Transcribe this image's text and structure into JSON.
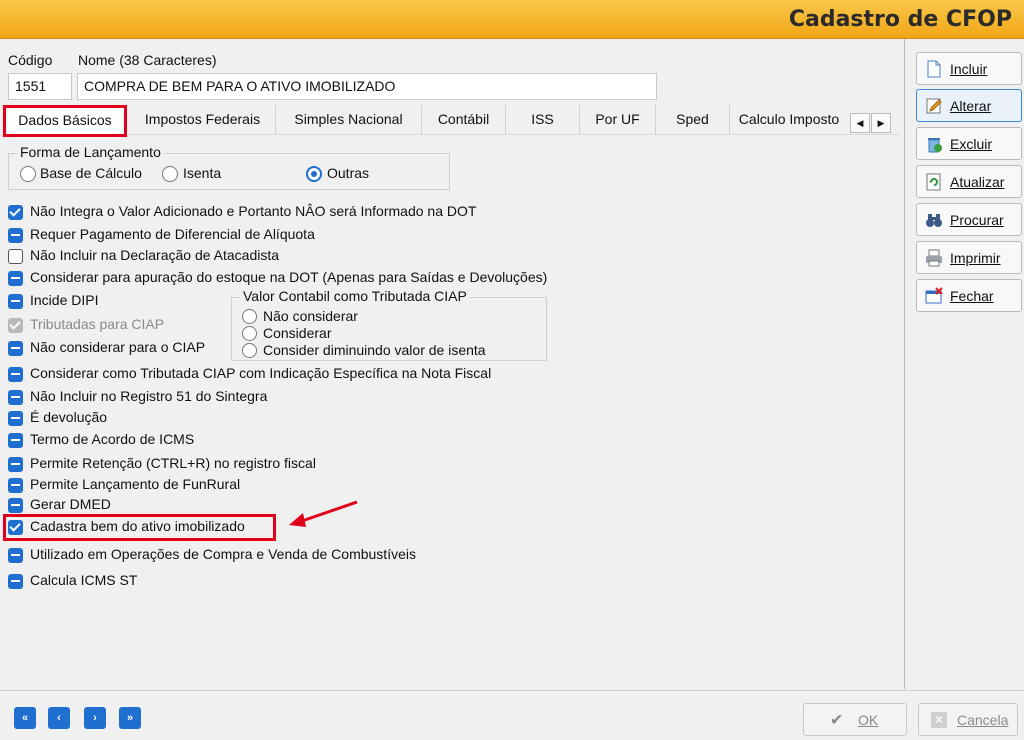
{
  "window": {
    "title": "Cadastro de CFOP"
  },
  "form": {
    "codigo_label": "Código",
    "nome_label": "Nome (38 Caracteres)",
    "codigo_value": "1551",
    "nome_value": "COMPRA DE BEM PARA O ATIVO IMOBILIZADO"
  },
  "tabs": [
    {
      "label": "Dados Básicos"
    },
    {
      "label": "Impostos Federais"
    },
    {
      "label": "Simples Nacional"
    },
    {
      "label": "Contábil"
    },
    {
      "label": "ISS"
    },
    {
      "label": "Por UF"
    },
    {
      "label": "Sped"
    },
    {
      "label": "Calculo Imposto"
    }
  ],
  "forma": {
    "title": "Forma de Lançamento",
    "options": [
      {
        "label": "Base de Cálculo"
      },
      {
        "label": "Isenta"
      },
      {
        "label": "Outras"
      }
    ],
    "selected": "Outras"
  },
  "checks": [
    {
      "label": "Não Integra o Valor Adicionado e Portanto NÂO será Informado na DOT",
      "state": "checked"
    },
    {
      "label": "Requer Pagamento de Diferencial de Alíquota",
      "state": "indeterminate"
    },
    {
      "label": "Não Incluir  na Declaração de Atacadista",
      "state": "unchecked"
    },
    {
      "label": "Considerar para apuração do estoque na DOT (Apenas para Saídas e Devoluções)",
      "state": "indeterminate"
    },
    {
      "label": "Incide DIPI",
      "state": "indeterminate"
    },
    {
      "label": "Tributadas para CIAP",
      "state": "disabled-checked"
    },
    {
      "label": "Não considerar para  o CIAP",
      "state": "indeterminate"
    },
    {
      "label": "Considerar como Tributada CIAP com Indicação Específica na Nota Fiscal",
      "state": "indeterminate"
    },
    {
      "label": "Não Incluir no Registro 51 do Sintegra",
      "state": "indeterminate"
    },
    {
      "label": "É devolução",
      "state": "indeterminate"
    },
    {
      "label": "Termo de Acordo de ICMS",
      "state": "indeterminate"
    },
    {
      "label": "Permite Retenção (CTRL+R) no registro fiscal",
      "state": "indeterminate"
    },
    {
      "label": "Permite Lançamento de FunRural",
      "state": "indeterminate"
    },
    {
      "label": "Gerar DMED",
      "state": "indeterminate"
    },
    {
      "label": "Cadastra bem do ativo imobilizado",
      "state": "checked"
    },
    {
      "label": "Utilizado em Operações de Compra e Venda de Combustíveis",
      "state": "indeterminate"
    },
    {
      "label": "Calcula ICMS ST",
      "state": "indeterminate"
    }
  ],
  "ciap_group": {
    "title": "Valor Contabil como Tributada CIAP",
    "options": [
      {
        "label": "Não considerar"
      },
      {
        "label": "Considerar"
      },
      {
        "label": "Consider diminuindo valor de isenta"
      }
    ]
  },
  "actions": [
    {
      "label": "Incluir",
      "icon": "document-icon"
    },
    {
      "label": "Alterar",
      "icon": "edit-icon"
    },
    {
      "label": "Excluir",
      "icon": "delete-icon"
    },
    {
      "label": "Atualizar",
      "icon": "refresh-icon"
    },
    {
      "label": "Procurar",
      "icon": "binoculars-icon"
    },
    {
      "label": "Imprimir",
      "icon": "printer-icon"
    },
    {
      "label": "Fechar",
      "icon": "close-window-icon"
    }
  ],
  "footer": {
    "nav": [
      "«",
      "‹",
      "›",
      "»"
    ],
    "ok_label": "OK",
    "cancel_label": "Cancela"
  },
  "colors": {
    "title_bar": "#f2a516",
    "accent": "#1f6fd1",
    "highlight": "#e0001b"
  }
}
